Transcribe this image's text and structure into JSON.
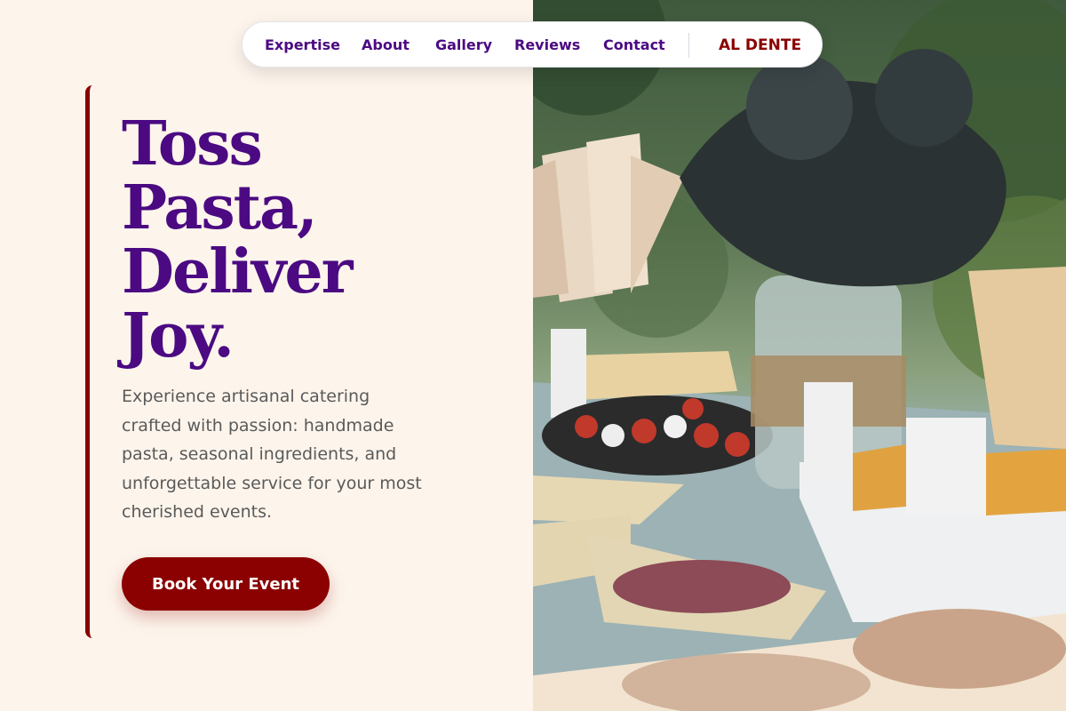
{
  "nav": {
    "links": [
      "Expertise",
      "About",
      "Gallery",
      "Reviews",
      "Contact"
    ],
    "brand": "AL DENTE"
  },
  "hero": {
    "headline_lines": [
      "Toss",
      "Pasta,",
      "Deliver",
      "Joy."
    ],
    "subtext": "Experience artisanal catering crafted with passion: handmade pasta, seasonal ingredients, and unforgettable service for your most cherished events.",
    "cta_label": "Book Your Event"
  },
  "colors": {
    "background": "#fdf5ec",
    "headline": "#4b0a82",
    "accent": "#8b0000",
    "nav_text": "#4b0a82",
    "body_text": "#5a5a5a"
  },
  "image": {
    "subject": "outdoor catering table with appetizers, cured meats, chips and a flower-filled jar"
  }
}
